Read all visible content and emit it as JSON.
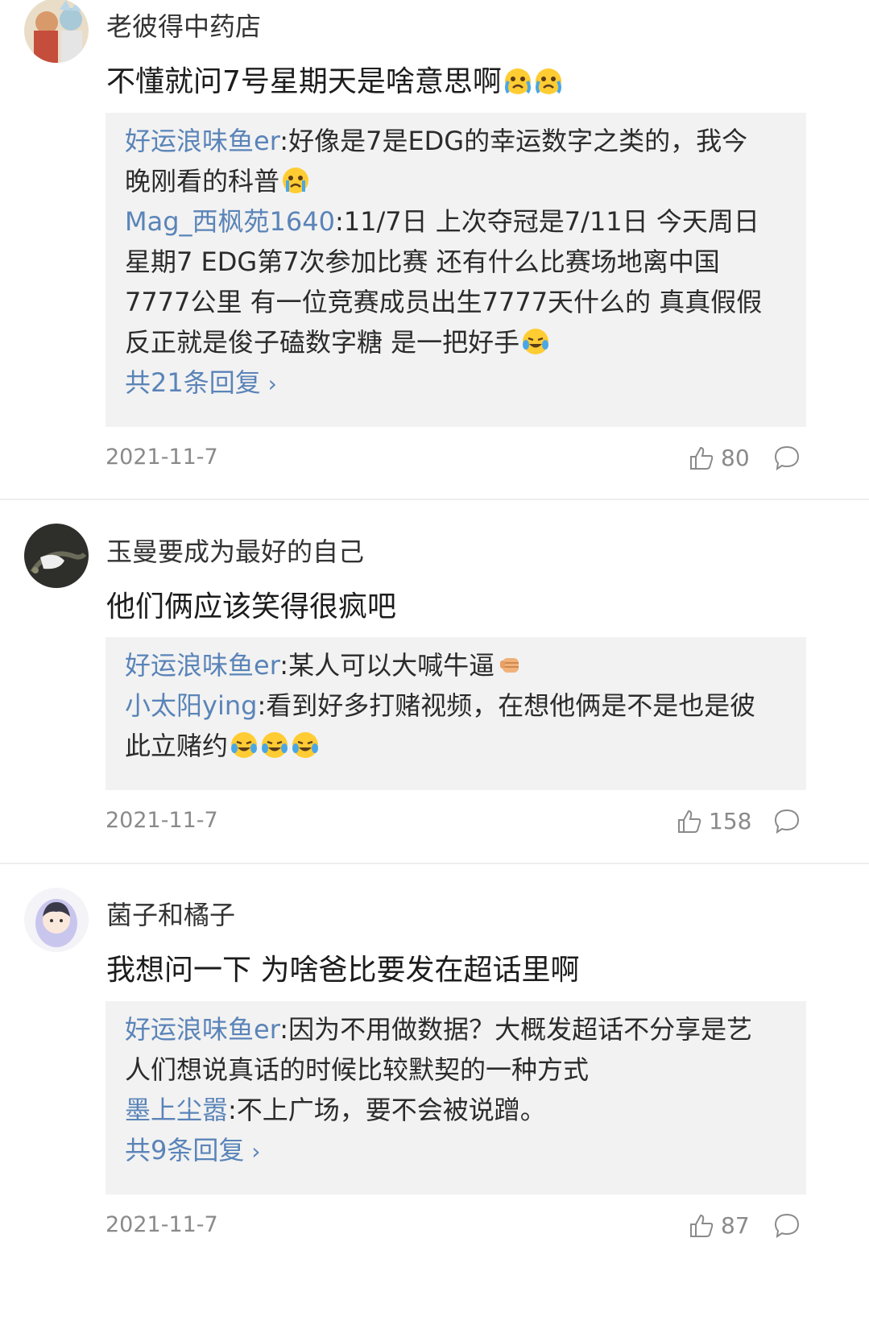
{
  "comments": [
    {
      "username": "老彼得中药店",
      "text": "不懂就问7号星期天是啥意思啊",
      "replies": [
        {
          "name": "好运浪味鱼er",
          "text": ":好像是7是EDG的幸运数字之类的，我今",
          "text2": "晚刚看的科普"
        },
        {
          "name": "Mag_西枫苑1640",
          "text": ":11/7日 上次夺冠是7/11日 今天周日",
          "text2": "星期7 EDG第7次参加比赛 还有什么比赛场地离中国",
          "text3": "7777公里 有一位竞赛成员出生7777天什么的 真真假假",
          "text4": "反正就是俊子磕数字糖 是一把好手"
        }
      ],
      "more": "共21条回复",
      "date": "2021-11-7",
      "likes": "80"
    },
    {
      "username": "玉曼要成为最好的自己",
      "text": "他们俩应该笑得很疯吧",
      "replies": [
        {
          "name": "好运浪味鱼er",
          "text": ":某人可以大喊牛逼"
        },
        {
          "name": "小太阳ying",
          "text": ":看到好多打赌视频，在想他俩是不是也是彼",
          "text2": "此立赌约"
        }
      ],
      "date": "2021-11-7",
      "likes": "158"
    },
    {
      "username": "菌子和橘子",
      "text": "我想问一下 为啥爸比要发在超话里啊",
      "replies": [
        {
          "name": "好运浪味鱼er",
          "text": ":因为不用做数据？大概发超话不分享是艺",
          "text2": "人们想说真话的时候比较默契的一种方式"
        },
        {
          "name": "墨上尘嚣",
          "text": ":不上广场，要不会被说蹭。"
        }
      ],
      "more": "共9条回复",
      "date": "2021-11-7",
      "likes": "87"
    }
  ],
  "icons": {
    "like": "thumbs-up-icon",
    "reply": "speech-bubble-icon",
    "chevron": "chevron-right-icon",
    "emoji_cry": "crying-face-icon",
    "emoji_laugh": "laughing-tears-icon",
    "emoji_fist": "fist-icon"
  },
  "colors": {
    "link": "#5a84b8",
    "reply_bg": "#f2f2f2",
    "meta": "#8a8a8a"
  }
}
